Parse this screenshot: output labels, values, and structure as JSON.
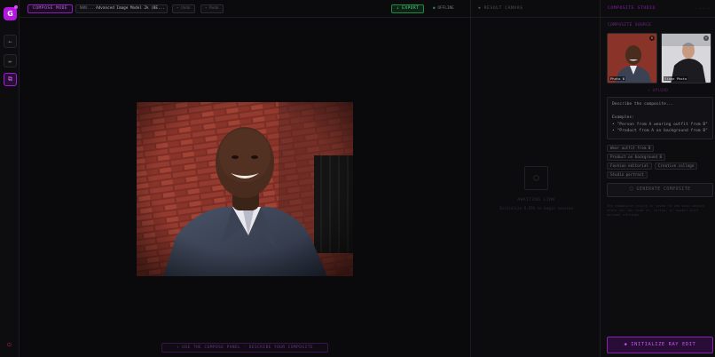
{
  "app": {
    "logo_letter": "G"
  },
  "rail": {
    "items": [
      {
        "icon": "arrow-icon",
        "glyph": "←"
      },
      {
        "icon": "pencil-icon",
        "glyph": "✏"
      },
      {
        "icon": "layers-icon",
        "glyph": "⧉"
      }
    ],
    "bottom_glyph": "⏻"
  },
  "topbar": {
    "mode_label": "COMPOSE MODE",
    "model_prefix": "NAN...",
    "model_name": "Advanced Image Model 2k (BE...",
    "ghost_1": "↶ Undo",
    "ghost_2": "↷ Redo",
    "export_label": "↓ EXPORT",
    "status_dot": "●",
    "status_label": "OFFLINE"
  },
  "canvas": {
    "hint": "↑ USE THE COMPOSE PANEL · DESCRIBE YOUR COMPOSITE"
  },
  "result": {
    "title": "◆ RESULT CANVAS",
    "empty_icon": "⬡",
    "empty_title": "AWAITING LINK",
    "empty_sub": "Initialize R.IPS to begin session"
  },
  "studio": {
    "title": "COMPOSITE STUDIO",
    "right_text": "— — — —",
    "sources_label": "COMPOSITE SOURCE",
    "thumb_1_caption": "Photo B",
    "thumb_2_caption": "Stage Photo",
    "thumb_close": "×",
    "upload_label": "↑ UPLOAD",
    "prompt_text": "Describe the composite...\n\nExamples:\n• \"Person from A wearing outfit from B\"\n• \"Product from A on background from B\"",
    "chips": [
      "Wear outfit from B",
      "Product on background B",
      "Fashion editorial",
      "Creative collage",
      "Studio portrait"
    ],
    "generate_label": "⬡ GENERATE COMPOSITE",
    "help_text": "The composite result is saved to the main canvas where you can zoom in, refine, or export with optimal settings.",
    "init_label": "◆ INITIALIZE RAY EDIT"
  },
  "colors": {
    "accent": "#b418e0",
    "export_green": "#3ee07a",
    "brick": "#8a3a30",
    "suit": "#3a4254"
  }
}
